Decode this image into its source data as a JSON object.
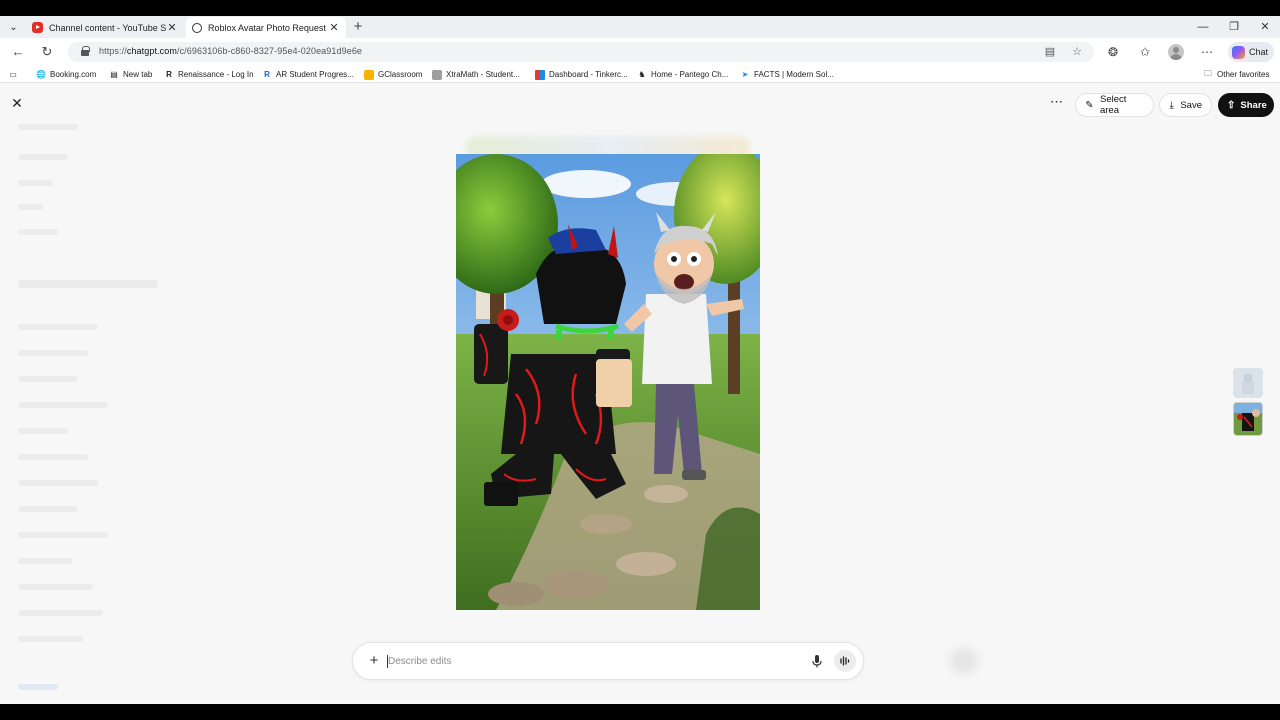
{
  "browser": {
    "tabs": [
      {
        "title": "Channel content - YouTube Studio",
        "favicon": "youtube-icon"
      },
      {
        "title": "Roblox Avatar Photo Request",
        "favicon": "chatgpt-icon",
        "active": true
      }
    ],
    "address": {
      "url_prefix": "https://",
      "url_host": "chatgpt.com",
      "url_path": "/c/6963106b-c860-8327-95e4-020ea91d9e6e"
    },
    "copilot_label": "Chat",
    "favorites": [
      {
        "label": "Booking.com",
        "icon": "globe-icon"
      },
      {
        "label": "New tab",
        "icon": "page-icon"
      },
      {
        "label": "Renaissance - Log In",
        "icon": "renaissance-icon"
      },
      {
        "label": "AR Student Progres...",
        "icon": "ar-icon"
      },
      {
        "label": "GClassroom",
        "icon": "classroom-icon"
      },
      {
        "label": "XtraMath - Student...",
        "icon": "xtramath-icon"
      },
      {
        "label": "Dashboard - Tinkerc...",
        "icon": "tinkercad-icon"
      },
      {
        "label": "Home - Pantego Ch...",
        "icon": "pantego-icon"
      },
      {
        "label": "FACTS | Modern Sol...",
        "icon": "facts-icon"
      }
    ],
    "other_favorites": "Other favorites"
  },
  "editor": {
    "select_area_label": "Select area",
    "save_label": "Save",
    "share_label": "Share",
    "composer_placeholder": "Describe edits"
  },
  "colors": {
    "share_bg": "#111111",
    "page_bg": "#f7f7f7",
    "youtube_red": "#e52d27"
  }
}
